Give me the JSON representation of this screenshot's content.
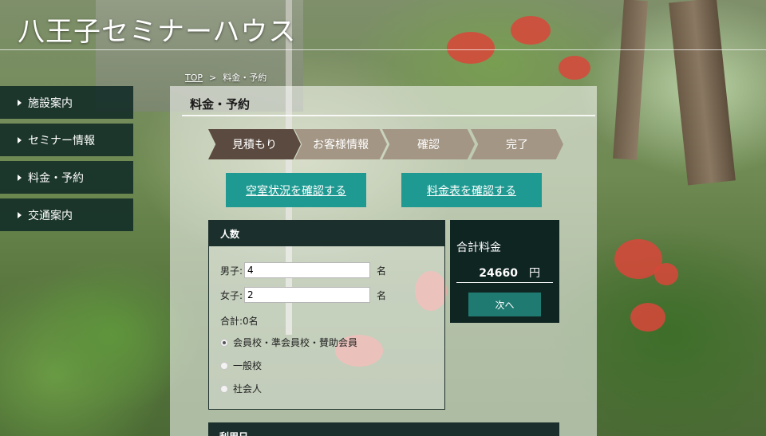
{
  "site": {
    "title": "八王子セミナーハウス"
  },
  "breadcrumb": {
    "home": "TOP",
    "separator": ">",
    "current": "料金・予約"
  },
  "sidebar": {
    "items": [
      {
        "label": "施設案内"
      },
      {
        "label": "セミナー情報"
      },
      {
        "label": "料金・予約"
      },
      {
        "label": "交通案内"
      }
    ]
  },
  "page": {
    "title": "料金・予約"
  },
  "steps": [
    {
      "label": "見積もり",
      "state": "active"
    },
    {
      "label": "お客様情報",
      "state": "inactive"
    },
    {
      "label": "確認",
      "state": "inactive"
    },
    {
      "label": "完了",
      "state": "inactive"
    }
  ],
  "buttons": {
    "availability": "空室状況を確認する",
    "price_table": "料金表を確認する"
  },
  "people": {
    "heading": "人数",
    "male_label": "男子:",
    "male_value": "4",
    "female_label": "女子:",
    "female_value": "2",
    "unit": "名",
    "total": "合計:0名",
    "categories": [
      {
        "label": "会員校・準会員校・賛助会員",
        "checked": true
      },
      {
        "label": "一般校",
        "checked": false
      },
      {
        "label": "社会人",
        "checked": false
      }
    ]
  },
  "summary": {
    "label": "合計料金",
    "amount": "24660",
    "currency": "円",
    "next": "次へ"
  },
  "date_panel": {
    "heading": "利用日"
  },
  "colors": {
    "sidebar_bg": "#102a26",
    "step_active": "#5b4a3f",
    "step_inactive": "#a39685",
    "teal_button": "#1f9a92",
    "panel_head": "#1b302c"
  }
}
